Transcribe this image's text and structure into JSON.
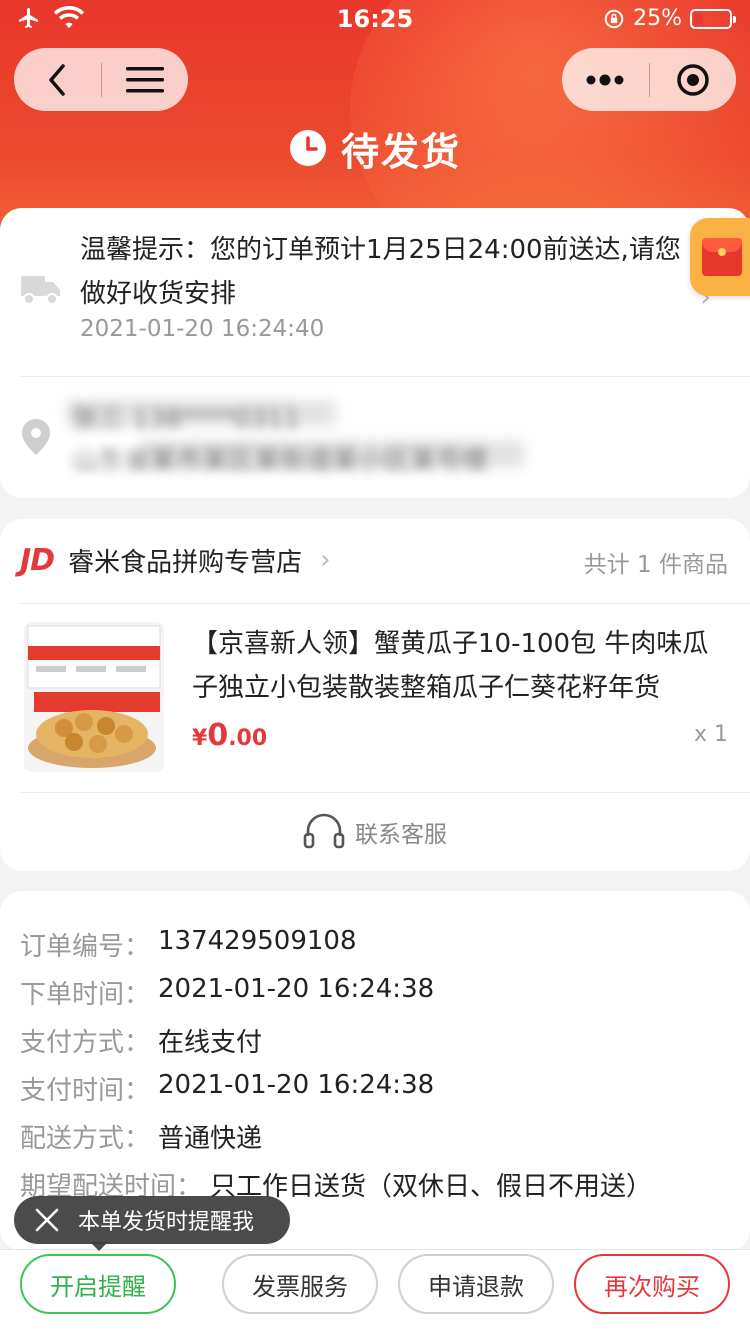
{
  "status_bar": {
    "time": "16:25",
    "battery_percent": "25%"
  },
  "header": {
    "title": "待发货"
  },
  "notice": {
    "text": "温馨提示：您的订单预计1月25日24:00前送达,请您做好收货安排",
    "time": "2021-01-20 16:24:40"
  },
  "address": {
    "line1_blurred": "张三 138****0311",
    "line2_blurred": "山东省某市某区某街道某小区某号楼"
  },
  "shop": {
    "logo": "JD",
    "name": "睿米食品拼购专营店",
    "item_count": "共计 1 件商品"
  },
  "product": {
    "title": "【京喜新人领】蟹黄瓜子10-100包 牛肉味瓜子独立小包装散装整箱瓜子仁葵花籽年货",
    "price_currency": "¥",
    "price_int": "0",
    "price_dec": ".00",
    "qty": "x 1"
  },
  "service": {
    "label": "联系客服"
  },
  "order_info": [
    {
      "label": "订单编号：",
      "value": "137429509108"
    },
    {
      "label": "下单时间：",
      "value": "2021-01-20 16:24:38"
    },
    {
      "label": "支付方式：",
      "value": "在线支付"
    },
    {
      "label": "支付时间：",
      "value": "2021-01-20 16:24:38"
    },
    {
      "label": "配送方式：",
      "value": "普通快递"
    },
    {
      "label": "期望配送时间：",
      "value": "只工作日送货（双休日、假日不用送）"
    }
  ],
  "tooltip": {
    "text": "本单发货时提醒我"
  },
  "bottom_buttons": {
    "remind": "开启提醒",
    "invoice": "发票服务",
    "refund": "申请退款",
    "rebuy": "再次购买"
  },
  "colors": {
    "brand_red": "#e4393c",
    "header_red": "#e9362b",
    "green": "#3ec35a"
  }
}
